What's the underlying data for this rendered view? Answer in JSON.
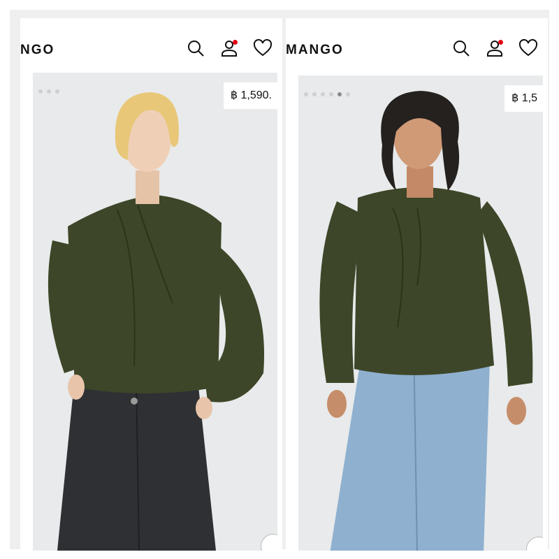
{
  "left": {
    "brand": "NGO",
    "price": "฿ 1,590.",
    "icons": [
      "search-icon",
      "account-icon",
      "wishlist-icon"
    ],
    "notification_color": "#e30613"
  },
  "right": {
    "brand": "MANGO",
    "price": "฿ 1,5",
    "icons": [
      "search-icon",
      "account-icon",
      "wishlist-icon"
    ],
    "notification_color": "#e30613"
  },
  "colors": {
    "blouse": "#3d4628",
    "background": "#e8eaeb",
    "black_jeans": "#2f3033",
    "blue_jeans": "#8fb0cf"
  }
}
